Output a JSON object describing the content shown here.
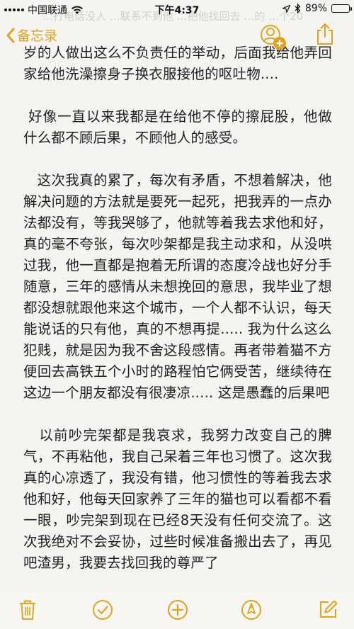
{
  "status_bar": {
    "carrier": "中国联通",
    "time": "下午4:37",
    "battery_percent": "89%",
    "battery_level": 0.89
  },
  "ghost_text": "…打电话没人 …联系不到他 …把他找回去  …的  …个20",
  "nav": {
    "back_label": "备忘录"
  },
  "note": {
    "paragraphs": [
      "岁的人做出这么不负责任的举动，后面我给他弄回家给他洗澡擦身子换衣服接他的呕吐物....",
      " 好像一直以来我都是在给他不停的擦屁股，他做什么都不顾后果，不顾他人的感受。",
      "   这次我真的累了，每次有矛盾，不想着解决，他解决问题的方法就是要死一起死，把我弄的一点办法都没有，等我哭够了，他就等着我去求他和好，真的毫不夸张，每次吵架都是我主动求和，从没哄过我，他一直都是抱着无所谓的态度冷战也好分手随意，三年的感情从未想挽回的意思，我毕业了想都没想就跟他来这个城市，一个人都不认识，每天能说话的只有他，真的不想再提..... 我为什么这么犯贱，就是因为我不舍这段感情。再者带着猫不方便回去高铁五个小时的路程怕它俩受苦，继续待在这边一个朋友都没有很凄凉..... 这是愚蠢的后果吧",
      "   以前吵完架都是我哀求，我努力改变自己的脾气，不再粘他，我自己呆着三年也习惯了。这次我真的心凉透了，我没有错，他习惯性的等着我去求他和好，他每天回家养了三年的猫也可以看都不看一眼，吵完架到现在已经8天没有任何交流了。这次我绝对不会妥协，过些时候准备搬出去了，再见吧渣男，我要去找回我的尊严了"
    ]
  },
  "colors": {
    "accent": "#e0a51e",
    "background": "#f6f5f1",
    "text": "#1f1f1f"
  },
  "icons": {
    "back": "chevron-left-icon",
    "add_people": "add-people-icon",
    "share": "share-icon",
    "trash": "trash-icon",
    "checklist": "checkmark-circle-icon",
    "add": "plus-circle-icon",
    "sketch": "pen-circle-icon",
    "compose": "compose-icon"
  }
}
